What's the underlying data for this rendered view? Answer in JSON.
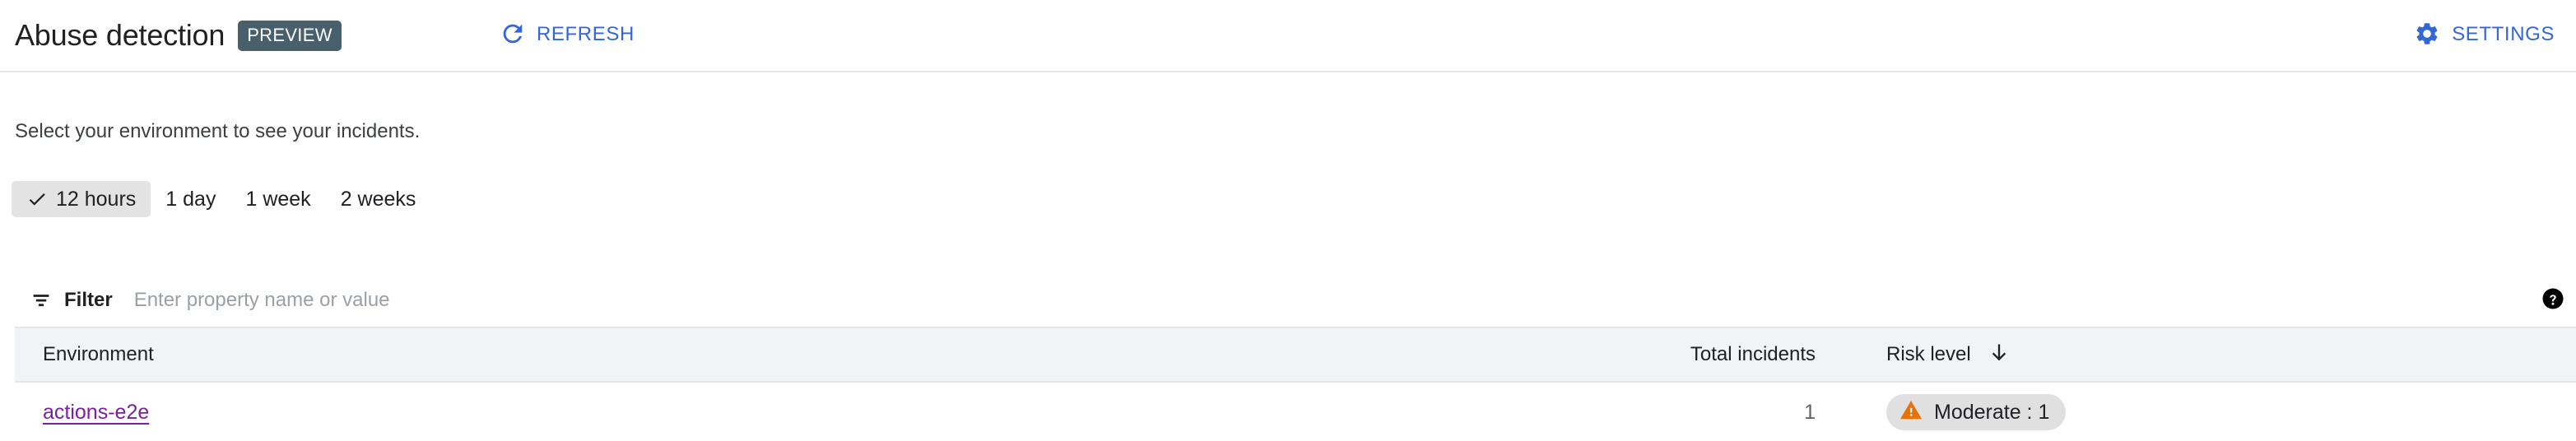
{
  "header": {
    "title": "Abuse detection",
    "preview_badge": "PREVIEW",
    "refresh_label": "REFRESH",
    "settings_label": "SETTINGS",
    "accent_color": "#3367d6",
    "badge_color": "#47606b"
  },
  "subtitle": "Select your environment to see your incidents.",
  "time_ranges": {
    "selected_index": 0,
    "items": [
      {
        "label": "12 hours",
        "selected": true
      },
      {
        "label": "1 day",
        "selected": false
      },
      {
        "label": "1 week",
        "selected": false
      },
      {
        "label": "2 weeks",
        "selected": false
      }
    ]
  },
  "filter": {
    "label": "Filter",
    "placeholder": "Enter property name or value",
    "value": "",
    "help_icon": "help-circle-icon",
    "filter_icon": "filter-list-icon"
  },
  "table": {
    "columns": [
      {
        "key": "environment",
        "label": "Environment",
        "sorted": false
      },
      {
        "key": "total_incidents",
        "label": "Total incidents",
        "sorted": false
      },
      {
        "key": "risk_level",
        "label": "Risk level",
        "sorted": true,
        "sort_direction": "desc"
      }
    ],
    "rows": [
      {
        "environment": "actions-e2e",
        "environment_link_color": "#7b1fa2",
        "total_incidents": "1",
        "risk_chip_label": "Moderate : 1",
        "risk_chip_icon": "warning-triangle-icon",
        "risk_chip_icon_color": "#e8710a",
        "risk_chip_bg": "#e0e0e0"
      }
    ]
  }
}
